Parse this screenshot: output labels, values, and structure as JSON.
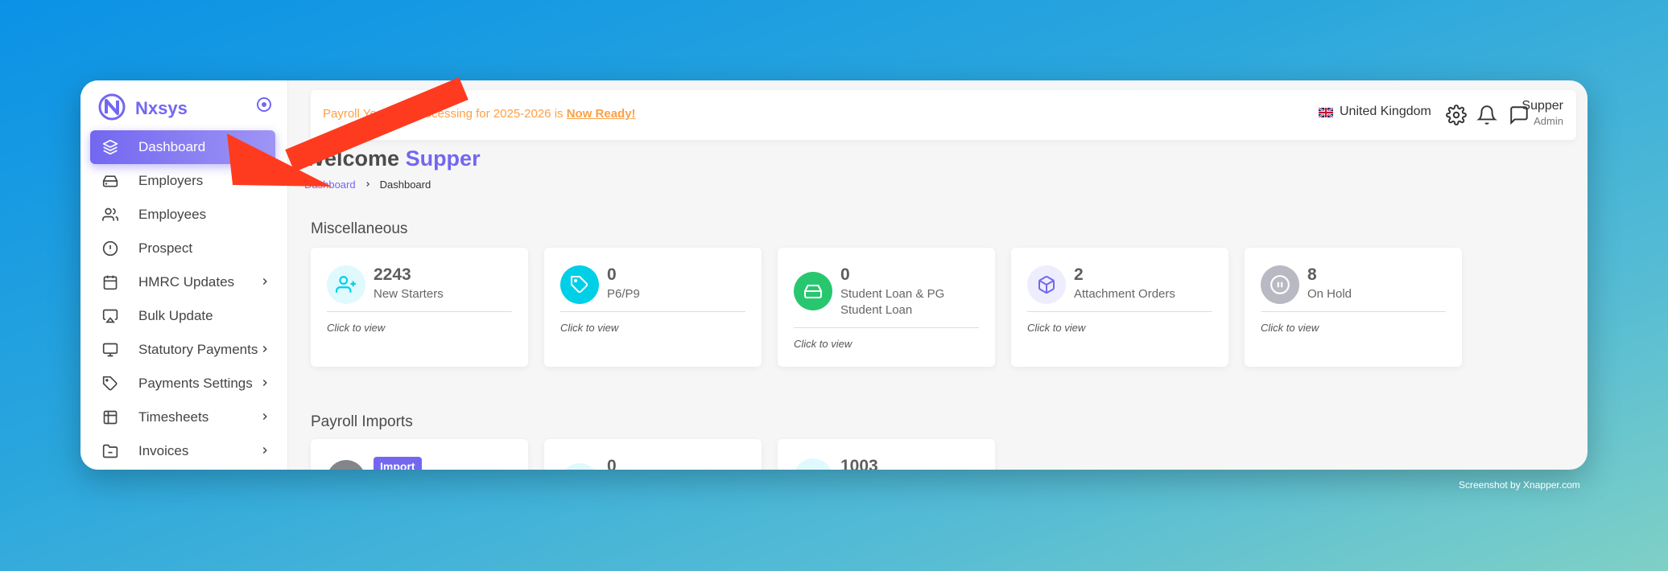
{
  "sidebar": {
    "brand": "Nxsys",
    "items": [
      {
        "label": "Dashboard",
        "icon": "layers-icon",
        "active": true,
        "has_chevron": false
      },
      {
        "label": "Employers",
        "icon": "drive-icon",
        "active": false,
        "has_chevron": false
      },
      {
        "label": "Employees",
        "icon": "users-icon",
        "active": false,
        "has_chevron": false
      },
      {
        "label": "Prospect",
        "icon": "alert-circle-icon",
        "active": false,
        "has_chevron": false
      },
      {
        "label": "HMRC Updates",
        "icon": "calendar-icon",
        "active": false,
        "has_chevron": true
      },
      {
        "label": "Bulk Update",
        "icon": "airplay-icon",
        "active": false,
        "has_chevron": false
      },
      {
        "label": "Statutory Payments",
        "icon": "monitor-icon",
        "active": false,
        "has_chevron": true
      },
      {
        "label": "Payments Settings",
        "icon": "tag-icon",
        "active": false,
        "has_chevron": true
      },
      {
        "label": "Timesheets",
        "icon": "table-icon",
        "active": false,
        "has_chevron": true
      },
      {
        "label": "Invoices",
        "icon": "folder-icon",
        "active": false,
        "has_chevron": true
      }
    ]
  },
  "topbar": {
    "notice_prefix": "Payroll Year end processing for 2025-2026 is ",
    "notice_link": "Now Ready!",
    "country": "United Kingdom",
    "user_name": "Supper",
    "user_role": "Admin"
  },
  "welcome": {
    "prefix": "Welcome ",
    "name": "Supper"
  },
  "breadcrumb": {
    "link": "Dashboard",
    "current": "Dashboard"
  },
  "misc": {
    "title": "Miscellaneous",
    "cards": [
      {
        "value": "2243",
        "label": "New Starters",
        "cta": "Click to view",
        "icon": "user-plus-icon",
        "color": "#00cfe8"
      },
      {
        "value": "0",
        "label": "P6/P9",
        "cta": "Click to view",
        "icon": "tag-icon",
        "color": "#00cfe8"
      },
      {
        "value": "0",
        "label": "Student Loan & PG Student Loan",
        "cta": "Click to view",
        "icon": "hard-drive-icon",
        "color": "#28c76f"
      },
      {
        "value": "2",
        "label": "Attachment Orders",
        "cta": "Click to view",
        "icon": "box-icon",
        "color": "#7367f0"
      },
      {
        "value": "8",
        "label": "On Hold",
        "cta": "Click to view",
        "icon": "pause-circle-icon",
        "color": "#b9b9c3"
      }
    ]
  },
  "imports": {
    "title": "Payroll Imports",
    "import_button": "Import",
    "values": [
      "0",
      "1003"
    ]
  },
  "watermark": "Screenshot by Xnapper.com",
  "colors": {
    "accent": "#7367f0",
    "warning": "#ff9f43",
    "arrow": "#ff3b1f"
  }
}
